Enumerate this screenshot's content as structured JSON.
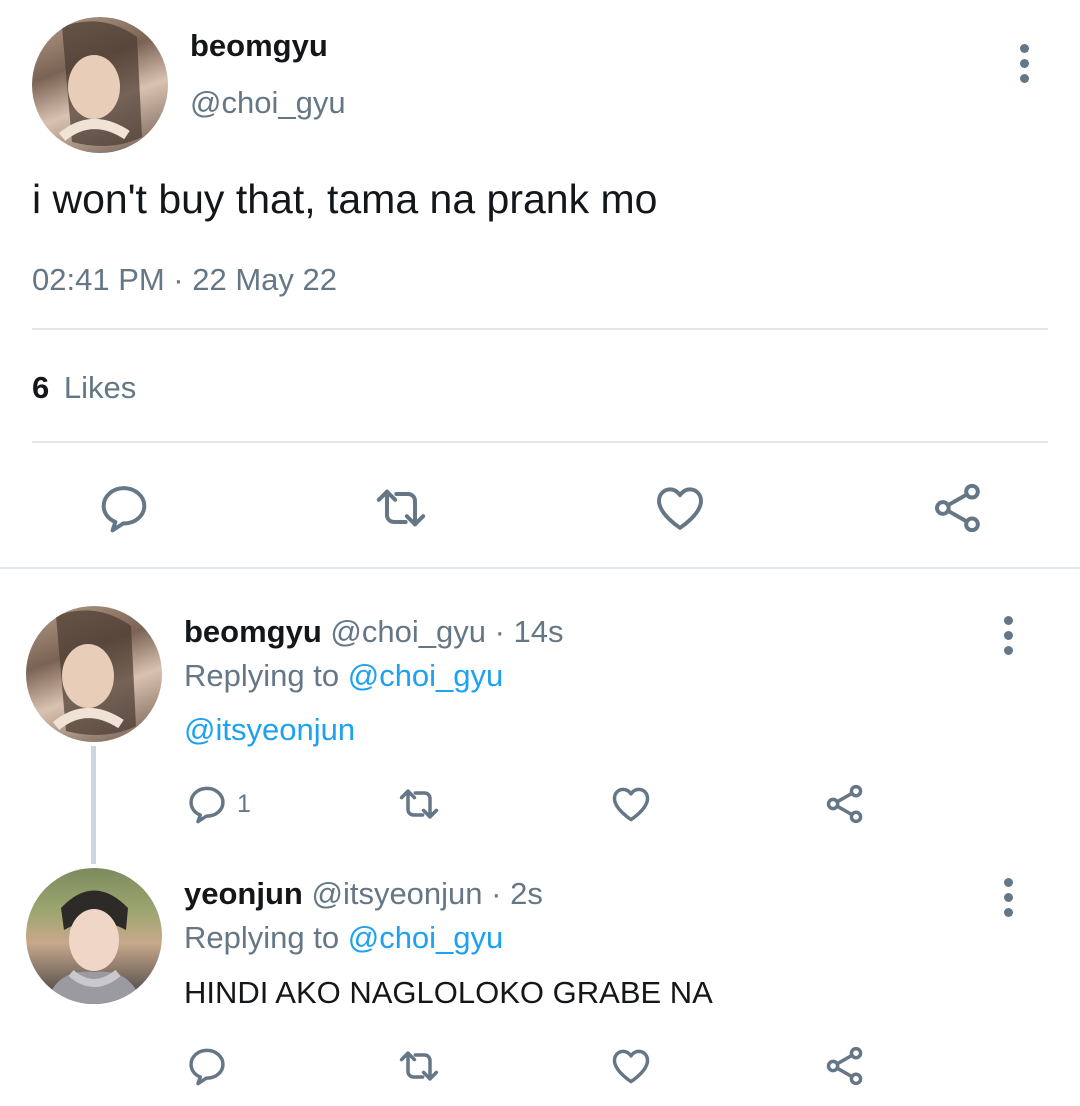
{
  "main_tweet": {
    "author_name": "beomgyu",
    "author_handle": "@choi_gyu",
    "text": "i won't buy that, tama na prank mo",
    "timestamp": "02:41 PM · 22 May 22",
    "likes_count": "6",
    "likes_label": "Likes"
  },
  "replies": [
    {
      "author_name": "beomgyu",
      "meta": "@choi_gyu · 14s",
      "replying_prefix": "Replying to",
      "replying_handle": "@choi_gyu",
      "text": "@itsyeonjun",
      "reply_count": "1"
    },
    {
      "author_name": "yeonjun",
      "meta": "@itsyeonjun · 2s",
      "replying_prefix": "Replying to",
      "replying_handle": "@choi_gyu",
      "text": "HINDI AKO NAGLOLOKO GRABE NA"
    }
  ],
  "colors": {
    "link": "#1da1f2",
    "secondary_text": "#657786",
    "divider": "#e1e8ed"
  },
  "icons": [
    "reply-icon",
    "retweet-icon",
    "like-icon",
    "share-icon",
    "more-options-icon"
  ]
}
